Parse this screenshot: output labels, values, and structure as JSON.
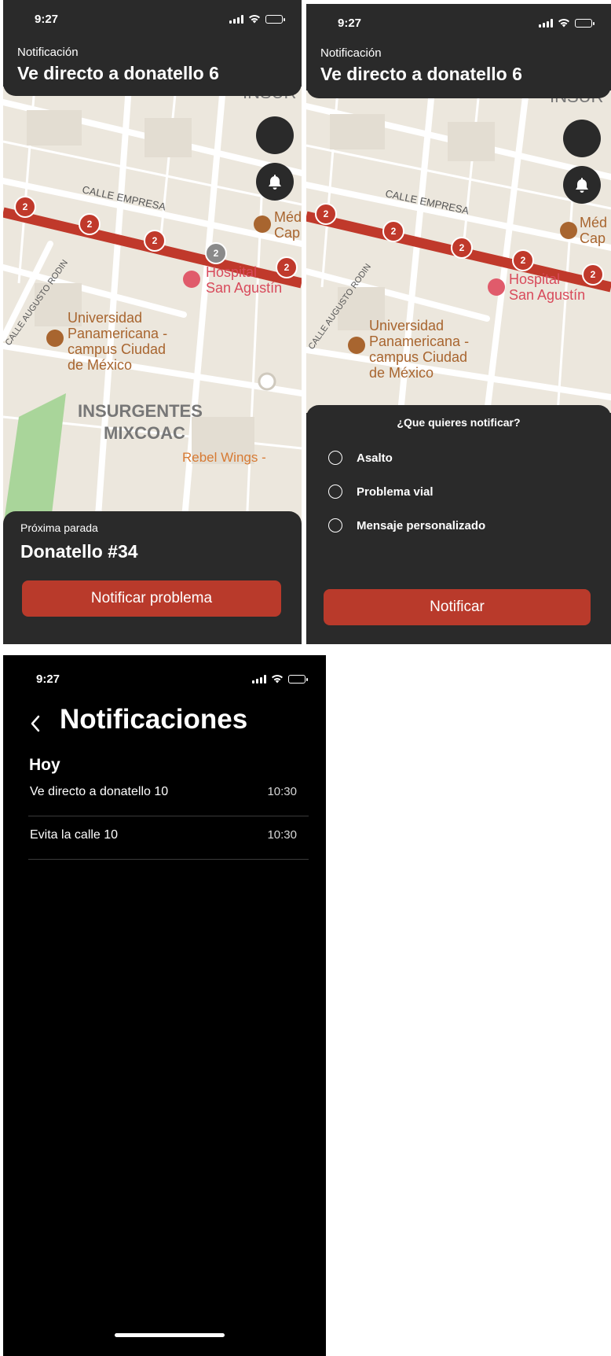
{
  "colors": {
    "accent": "#b93a2b",
    "surface": "#2a2a2a",
    "background": "#000000",
    "route": "#c0392b"
  },
  "status": {
    "time": "9:27"
  },
  "screen1": {
    "header": {
      "label": "Notificación",
      "title": "Ve directo a donatello 6"
    },
    "sheet": {
      "label": "Próxima parada",
      "stop": "Donatello #34",
      "button": "Notificar problema"
    },
    "fabs": [
      "location-icon",
      "bell-icon"
    ]
  },
  "screen2": {
    "header": {
      "label": "Notificación",
      "title": "Ve directo a donatello 6"
    },
    "sheet": {
      "question": "¿Que quieres notificar?",
      "options": [
        "Asalto",
        "Problema vial",
        "Mensaje personalizado"
      ],
      "button": "Notificar"
    }
  },
  "screen3": {
    "title": "Notificaciones",
    "section": "Hoy",
    "items": [
      {
        "text": "Ve directo a donatello 10",
        "time": "10:30"
      },
      {
        "text": "Evita la calle 10",
        "time": "10:30"
      }
    ]
  },
  "map": {
    "streets": [
      "CALLE EMPRESA",
      "CALLE AUGUSTO RODIN",
      "INSUR",
      "INSURGENTES",
      "MIXCOAC"
    ],
    "places": [
      "Universidad",
      "Panamericana -",
      "campus Ciudad",
      "de México",
      "Hospital",
      "San Agustín",
      "Médica",
      "Cap",
      "Rebel Wings -"
    ],
    "marker_count": "2"
  }
}
